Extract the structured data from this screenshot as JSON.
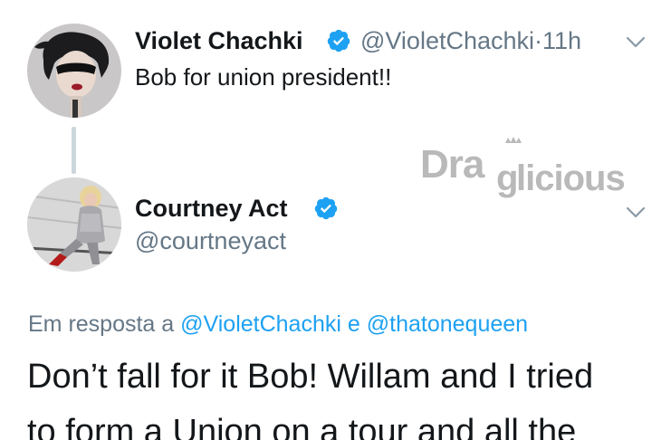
{
  "tweet1": {
    "display_name": "Violet Chachki",
    "handle": "@VioletChachki",
    "separator": "·",
    "time": "11h",
    "text": "Bob for union president!!"
  },
  "tweet2": {
    "display_name": "Courtney Act",
    "handle": "@courtneyact",
    "reply_prefix": "Em resposta a",
    "reply_mention_1": "@VioletChachki",
    "reply_conjunction": "e",
    "reply_mention_2": "@thatonequeen",
    "text_line_1": "Don’t fall for it Bob! Willam and I tried",
    "text_line_2": "to form a Union on a tour and all the"
  },
  "watermark": {
    "text": "Draglicious"
  },
  "colors": {
    "verified_badge": "#1da1f2",
    "link": "#1da1f2",
    "secondary_text": "#657786",
    "thread_line": "#ccd6dd"
  },
  "icons": {
    "verified": "verified-badge-icon",
    "caret": "chevron-down-icon",
    "avatar_1": "avatar-violet-chachki",
    "avatar_2": "avatar-courtney-act"
  }
}
